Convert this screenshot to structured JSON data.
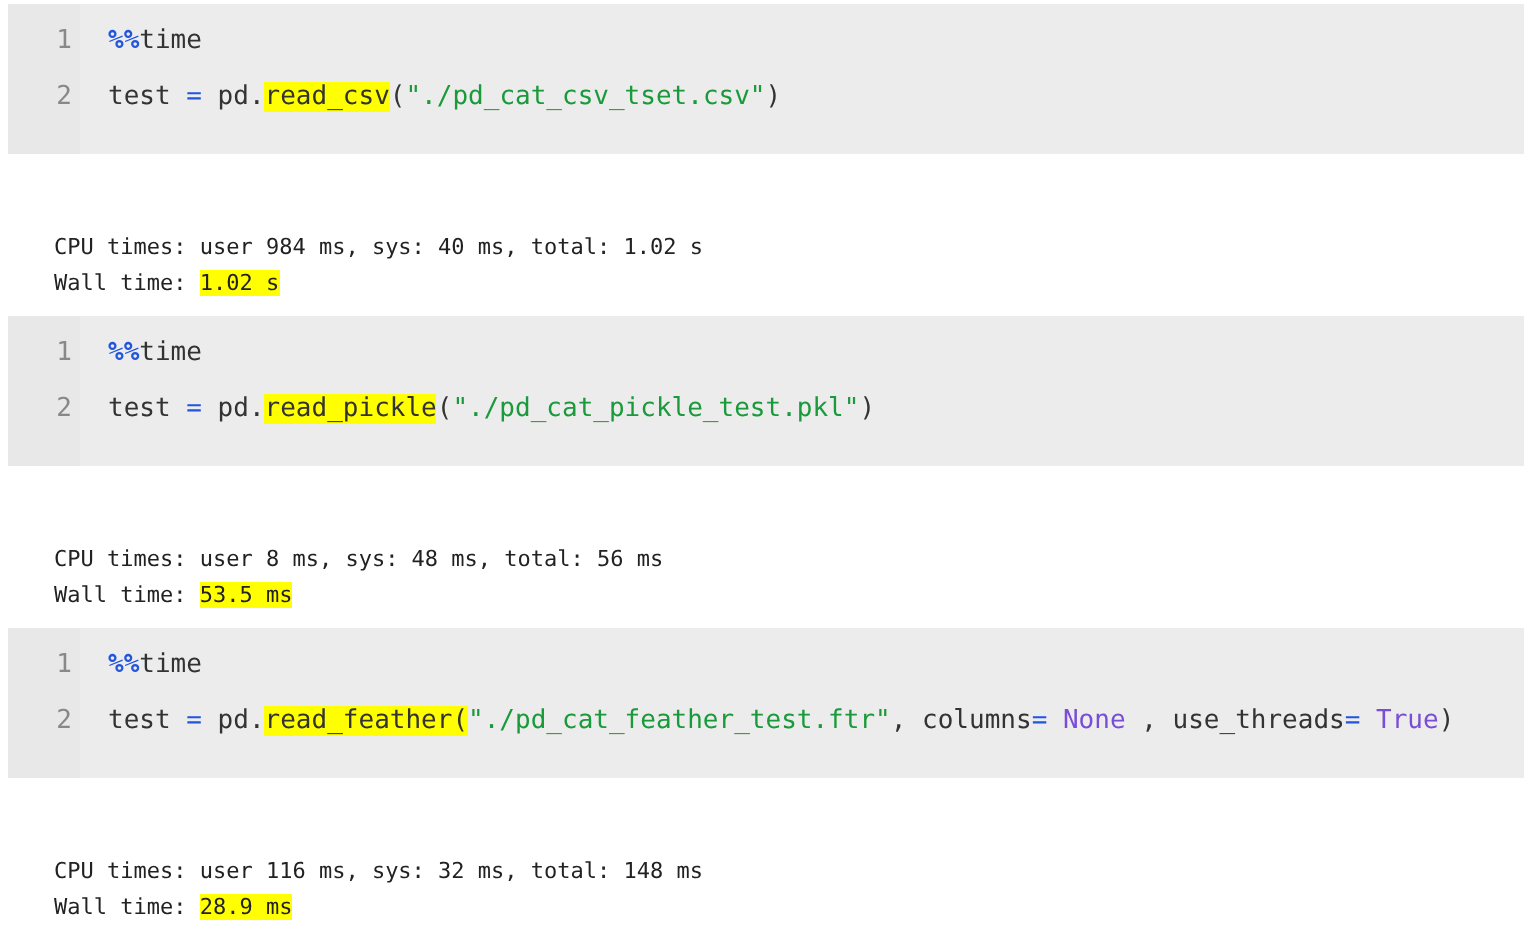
{
  "cells": [
    {
      "code": [
        {
          "number": "1",
          "tokens": [
            {
              "kind": "magic",
              "text": "%%",
              "highlighted": false
            },
            {
              "kind": "plain",
              "text": "time",
              "highlighted": false
            }
          ]
        },
        {
          "number": "2",
          "tokens": [
            {
              "kind": "plain",
              "text": "test ",
              "highlighted": false
            },
            {
              "kind": "operator",
              "text": "=",
              "highlighted": false
            },
            {
              "kind": "plain",
              "text": " pd.",
              "highlighted": false
            },
            {
              "kind": "plain",
              "text": "read_csv",
              "highlighted": true
            },
            {
              "kind": "plain",
              "text": "(",
              "highlighted": false
            },
            {
              "kind": "string",
              "text": "\"./pd_cat_csv_tset.csv\"",
              "highlighted": false
            },
            {
              "kind": "plain",
              "text": ")",
              "highlighted": false
            }
          ]
        }
      ],
      "output": [
        {
          "tokens": [
            {
              "text": "CPU times: user 984 ms, sys: 40 ms, total: 1.02 s",
              "highlighted": false
            }
          ]
        },
        {
          "tokens": [
            {
              "text": "Wall time: ",
              "highlighted": false
            },
            {
              "text": "1.02 s",
              "highlighted": true
            }
          ]
        }
      ]
    },
    {
      "code": [
        {
          "number": "1",
          "tokens": [
            {
              "kind": "magic",
              "text": "%%",
              "highlighted": false
            },
            {
              "kind": "plain",
              "text": "time",
              "highlighted": false
            }
          ]
        },
        {
          "number": "2",
          "tokens": [
            {
              "kind": "plain",
              "text": "test ",
              "highlighted": false
            },
            {
              "kind": "operator",
              "text": "=",
              "highlighted": false
            },
            {
              "kind": "plain",
              "text": " pd.",
              "highlighted": false
            },
            {
              "kind": "plain",
              "text": "read_pickle",
              "highlighted": true
            },
            {
              "kind": "plain",
              "text": "(",
              "highlighted": false
            },
            {
              "kind": "string",
              "text": "\"./pd_cat_pickle_test.pkl\"",
              "highlighted": false
            },
            {
              "kind": "plain",
              "text": ")",
              "highlighted": false
            }
          ]
        }
      ],
      "output": [
        {
          "tokens": [
            {
              "text": "CPU times: user 8 ms, sys: 48 ms, total: 56 ms",
              "highlighted": false
            }
          ]
        },
        {
          "tokens": [
            {
              "text": "Wall time: ",
              "highlighted": false
            },
            {
              "text": "53.5 ms",
              "highlighted": true
            }
          ]
        }
      ]
    },
    {
      "code": [
        {
          "number": "1",
          "tokens": [
            {
              "kind": "magic",
              "text": "%%",
              "highlighted": false
            },
            {
              "kind": "plain",
              "text": "time",
              "highlighted": false
            }
          ]
        },
        {
          "number": "2",
          "tokens": [
            {
              "kind": "plain",
              "text": "test ",
              "highlighted": false
            },
            {
              "kind": "operator",
              "text": "=",
              "highlighted": false
            },
            {
              "kind": "plain",
              "text": " pd.",
              "highlighted": false
            },
            {
              "kind": "plain",
              "text": "read_feather(",
              "highlighted": true
            },
            {
              "kind": "string",
              "text": "\"./pd_cat_feather_test.ftr\"",
              "highlighted": false
            },
            {
              "kind": "plain",
              "text": ", columns",
              "highlighted": false
            },
            {
              "kind": "operator",
              "text": "= ",
              "highlighted": false
            },
            {
              "kind": "keyword",
              "text": "None",
              "highlighted": false
            },
            {
              "kind": "plain",
              "text": " , use_threads",
              "highlighted": false
            },
            {
              "kind": "operator",
              "text": "= ",
              "highlighted": false
            },
            {
              "kind": "keyword",
              "text": "True",
              "highlighted": false
            },
            {
              "kind": "plain",
              "text": ")",
              "highlighted": false
            }
          ]
        }
      ],
      "output": [
        {
          "tokens": [
            {
              "text": "CPU times: user 116 ms, sys: 32 ms, total: 148 ms",
              "highlighted": false
            }
          ]
        },
        {
          "tokens": [
            {
              "text": "Wall time: ",
              "highlighted": false
            },
            {
              "text": "28.9 ms",
              "highlighted": true
            }
          ]
        }
      ]
    }
  ]
}
